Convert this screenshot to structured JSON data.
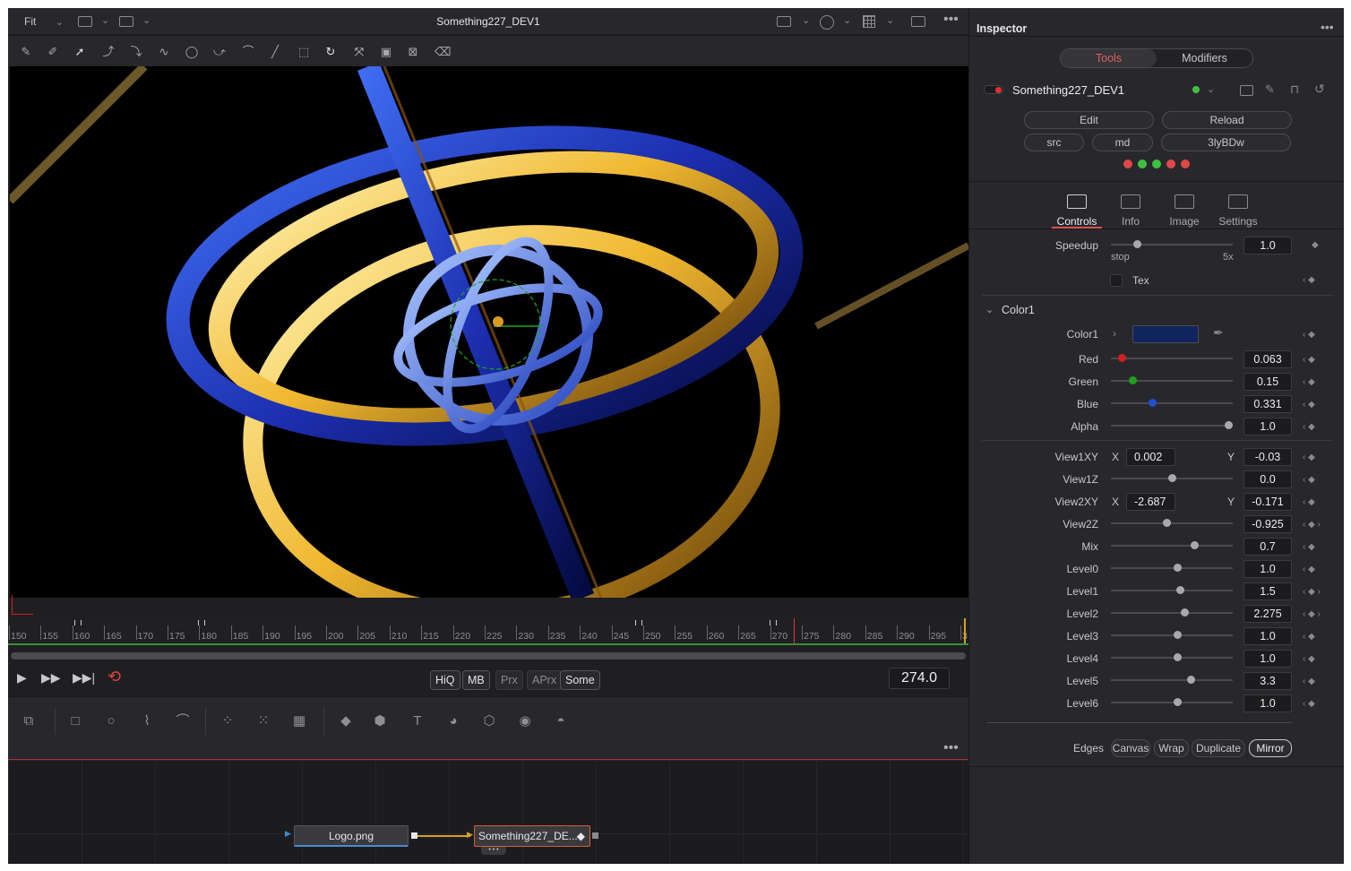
{
  "viewer": {
    "fit_label": "Fit",
    "title": "Something227_DEV1",
    "ruler_ticks": [
      "150",
      "155",
      "160",
      "165",
      "170",
      "175",
      "180",
      "185",
      "190",
      "195",
      "200",
      "205",
      "210",
      "215",
      "220",
      "225",
      "230",
      "235",
      "240",
      "245",
      "250",
      "255",
      "260",
      "265",
      "270",
      "275",
      "280",
      "285",
      "290",
      "295",
      "3"
    ],
    "quality_buttons": [
      "HiQ",
      "MB",
      "Prx",
      "APrx",
      "Some"
    ],
    "current_frame": "274.0"
  },
  "node_editor": {
    "nodes": [
      {
        "label": "Logo.png"
      },
      {
        "label": "Something227_DE..."
      }
    ]
  },
  "inspector": {
    "title": "Inspector",
    "top_tabs": [
      "Tools",
      "Modifiers"
    ],
    "tool_name": "Something227_DEV1",
    "buttons": {
      "edit": "Edit",
      "reload": "Reload",
      "src": "src",
      "md": "md",
      "id": "3lyBDw"
    },
    "dots": [
      "#e04848",
      "#40c040",
      "#40c040",
      "#e04848",
      "#e04848"
    ],
    "subtabs": [
      "Controls",
      "Info",
      "Image",
      "Settings"
    ],
    "speedup": {
      "label": "Speedup",
      "value": "1.0",
      "min_label": "stop",
      "max_label": "5x"
    },
    "tex_label": "Tex",
    "section": "Color1",
    "color1_label": "Color1",
    "color1_swatch": "#10245e",
    "rows": [
      {
        "label": "Red",
        "value": "0.063",
        "knob_color": "#d02020"
      },
      {
        "label": "Green",
        "value": "0.15",
        "knob_color": "#20a020"
      },
      {
        "label": "Blue",
        "value": "0.331",
        "knob_color": "#2050d0"
      },
      {
        "label": "Alpha",
        "value": "1.0",
        "knob_color": "#a8a8ae"
      }
    ],
    "view1xy": {
      "label": "View1XY",
      "x": "0.002",
      "y": "-0.03"
    },
    "view1z": {
      "label": "View1Z",
      "value": "0.0"
    },
    "view2xy": {
      "label": "View2XY",
      "x": "-2.687",
      "y": "-0.171"
    },
    "sliders": [
      {
        "label": "View2Z",
        "value": "-0.925"
      },
      {
        "label": "Mix",
        "value": "0.7"
      },
      {
        "label": "Level0",
        "value": "1.0"
      },
      {
        "label": "Level1",
        "value": "1.5"
      },
      {
        "label": "Level2",
        "value": "2.275"
      },
      {
        "label": "Level3",
        "value": "1.0"
      },
      {
        "label": "Level4",
        "value": "1.0"
      },
      {
        "label": "Level5",
        "value": "3.3"
      },
      {
        "label": "Level6",
        "value": "1.0"
      }
    ],
    "edges": {
      "label": "Edges",
      "options": [
        "Canvas",
        "Wrap",
        "Duplicate",
        "Mirror"
      ],
      "selected": "Mirror"
    },
    "x_label": "X",
    "y_label": "Y"
  }
}
